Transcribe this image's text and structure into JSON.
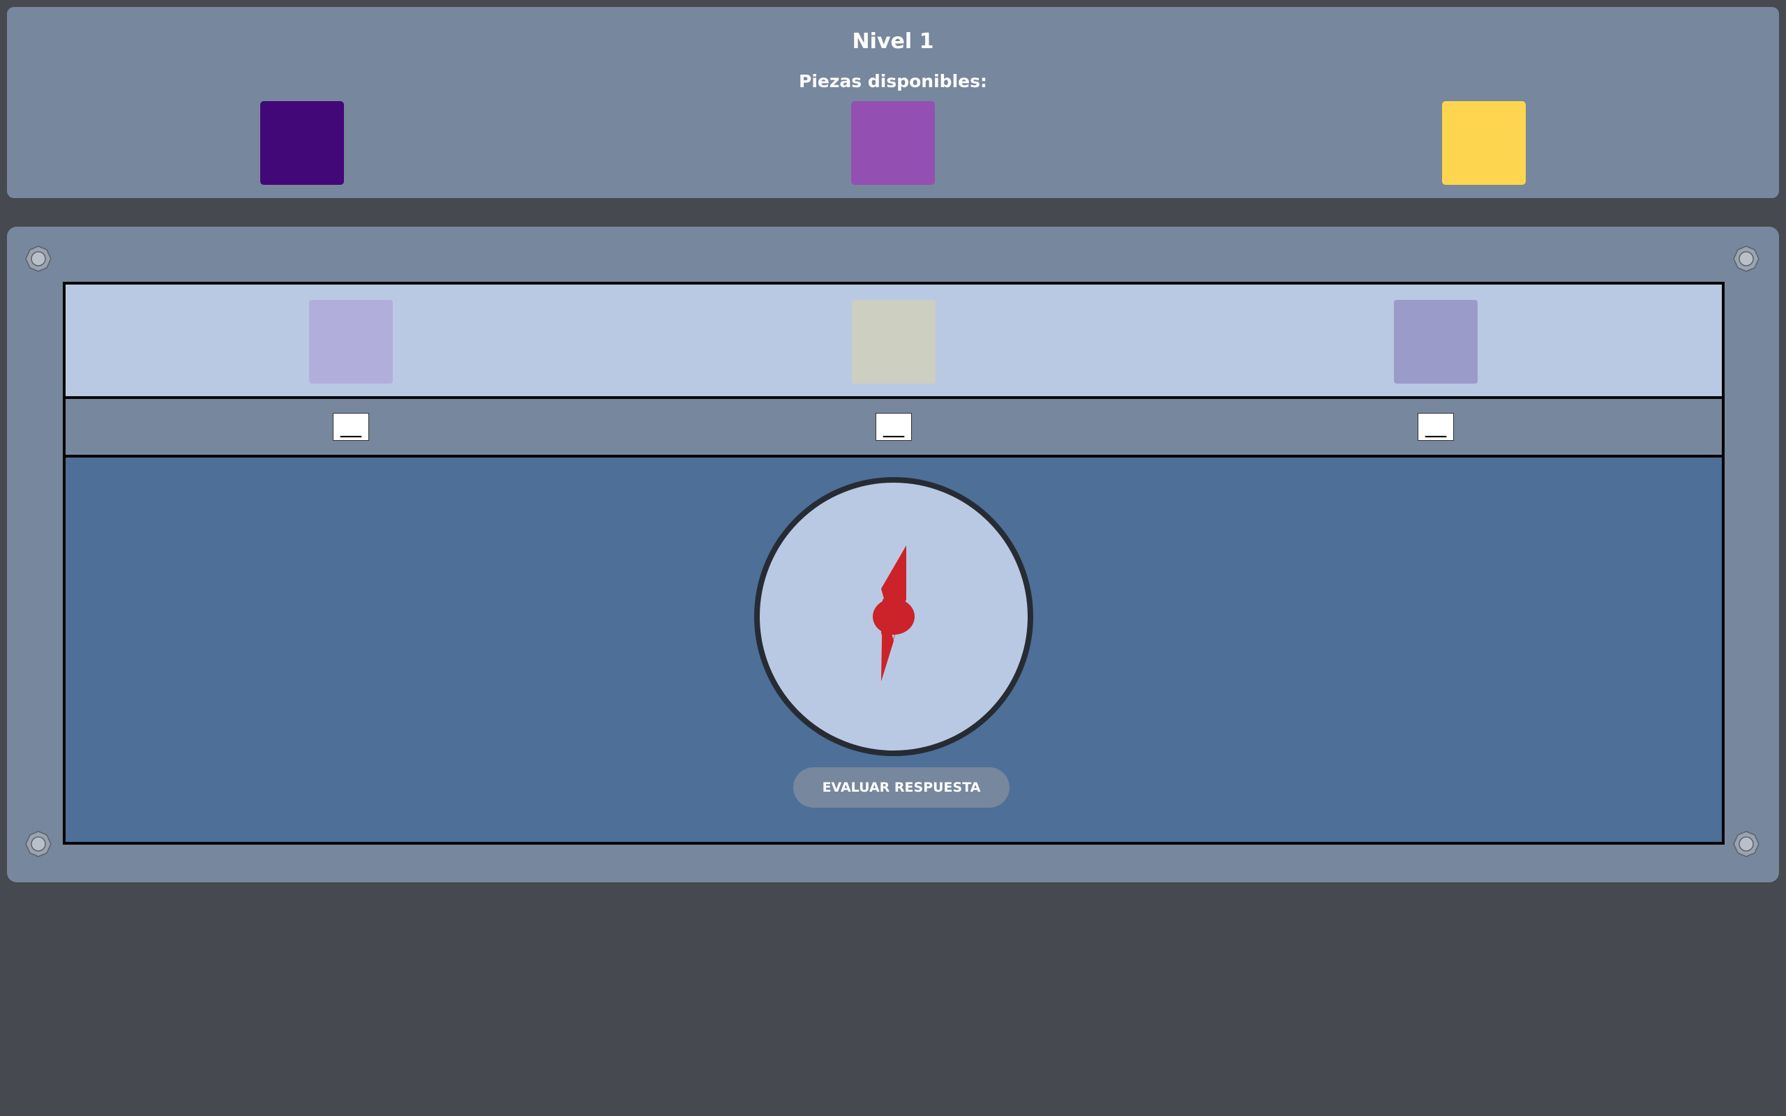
{
  "header": {
    "level_title": "Nivel 1",
    "pieces_label": "Piezas disponibles:"
  },
  "available_pieces": [
    {
      "color": "#420877"
    },
    {
      "color": "#944fb3"
    },
    {
      "color": "#fed54e"
    }
  ],
  "target_slots": [
    {
      "color": "#b2aedb",
      "value": "__"
    },
    {
      "color": "#cdcfc1",
      "value": "__"
    },
    {
      "color": "#9b9bc9",
      "value": "__"
    }
  ],
  "compass": {
    "face_color": "#bac9e3",
    "rim_color": "#272b34",
    "needle_color": "#cc2229"
  },
  "actions": {
    "evaluate_label": "EVALUAR RESPUESTA"
  },
  "colors": {
    "background": "#46494f",
    "panel": "#77879d",
    "board_inner": "#4d6f98"
  }
}
